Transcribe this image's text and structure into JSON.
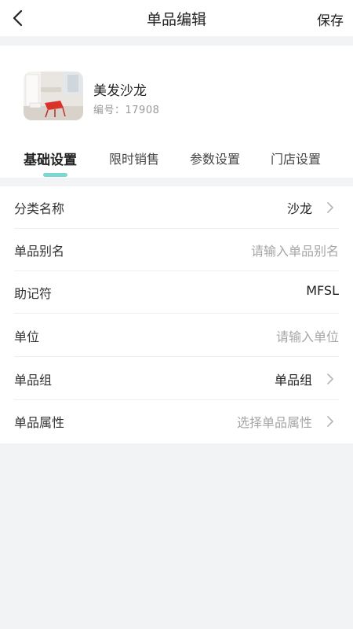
{
  "navbar": {
    "title": "单品编辑",
    "save_label": "保存"
  },
  "product": {
    "name": "美发沙龙",
    "code": "编号：17908"
  },
  "tabs": [
    {
      "label": "基础设置"
    },
    {
      "label": "限时销售"
    },
    {
      "label": "参数设置"
    },
    {
      "label": "门店设置"
    }
  ],
  "form": {
    "category": {
      "label": "分类名称",
      "value": "沙龙"
    },
    "alias": {
      "label": "单品别名",
      "placeholder": "请输入单品别名"
    },
    "mnemonic": {
      "label": "助记符",
      "value": "MFSL"
    },
    "unit": {
      "label": "单位",
      "placeholder": "请输入单位"
    },
    "group": {
      "label": "单品组",
      "value": "单品组"
    },
    "attributes": {
      "label": "单品属性",
      "placeholder": "选择单品属性"
    }
  },
  "colors": {
    "tab_indicator": "#7ad7d2",
    "page_bg": "#f2f3f5"
  }
}
